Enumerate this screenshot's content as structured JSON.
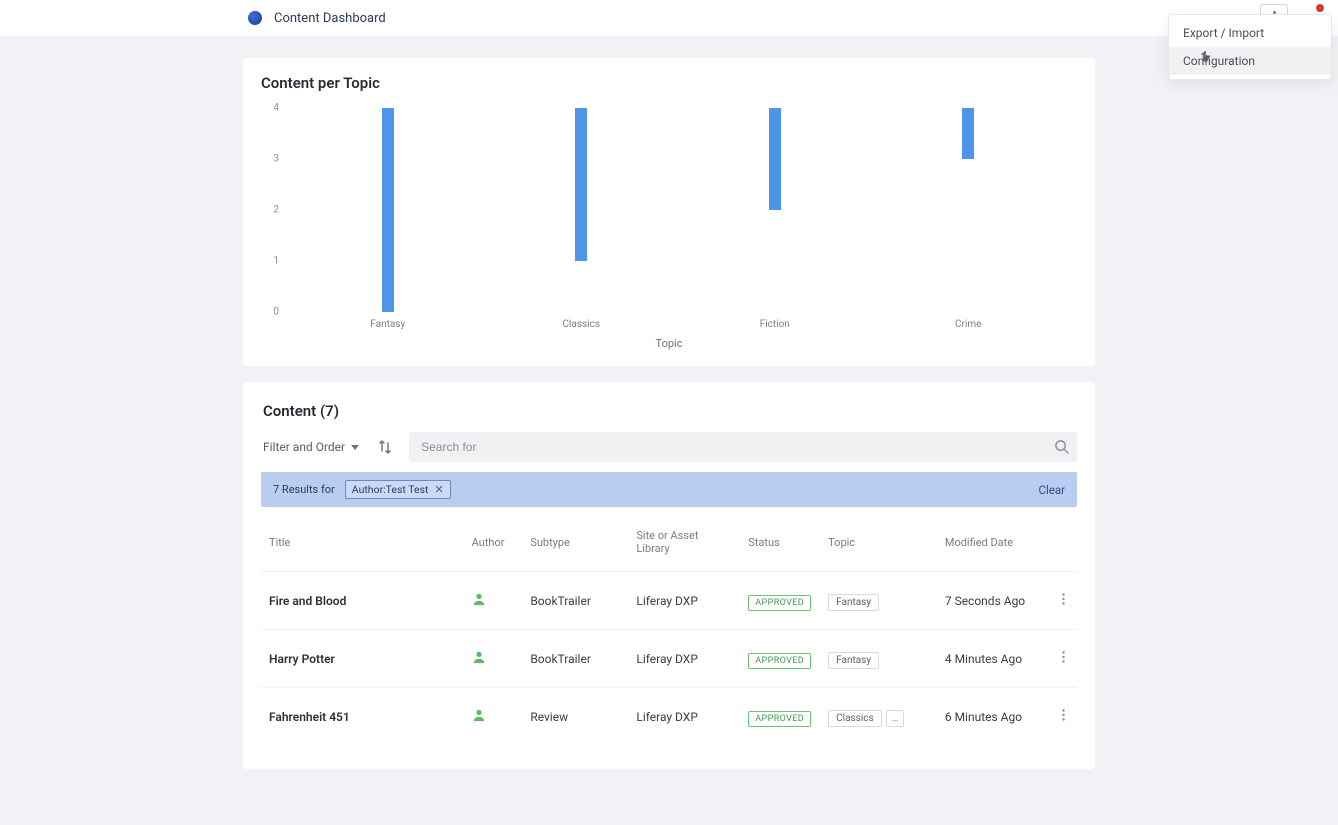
{
  "header": {
    "title": "Content Dashboard"
  },
  "kebab_menu": {
    "items": [
      {
        "label": "Export / Import"
      },
      {
        "label": "Configuration"
      }
    ],
    "hovered_index": 1
  },
  "cards": {
    "chart": {
      "title": "Content per Topic"
    },
    "content": {
      "title_prefix": "Content",
      "count_display": "(7)"
    }
  },
  "chart_data": {
    "type": "bar",
    "title": "Content per Topic",
    "xlabel": "Topic",
    "ylabel": "",
    "ylim": [
      0,
      4
    ],
    "yticks": [
      0,
      1,
      2,
      3,
      4
    ],
    "categories": [
      "Fantasy",
      "Classics",
      "Fiction",
      "Crime"
    ],
    "values": [
      4,
      3,
      2,
      1
    ]
  },
  "toolbar": {
    "filter_order_label": "Filter and Order",
    "search_placeholder": "Search for"
  },
  "filter_summary": {
    "lead": "7 Results for",
    "chip_label": "Author:Test Test",
    "clear_label": "Clear"
  },
  "table": {
    "columns": [
      "Title",
      "Author",
      "Subtype",
      "Site or Asset Library",
      "Status",
      "Topic",
      "Modified Date"
    ],
    "rows": [
      {
        "title": "Fire and Blood",
        "subtype": "BookTrailer",
        "site": "Liferay DXP",
        "status": "APPROVED",
        "topics": [
          "Fantasy"
        ],
        "more_topics": false,
        "modified": "7 Seconds Ago"
      },
      {
        "title": "Harry Potter",
        "subtype": "BookTrailer",
        "site": "Liferay DXP",
        "status": "APPROVED",
        "topics": [
          "Fantasy"
        ],
        "more_topics": false,
        "modified": "4 Minutes Ago"
      },
      {
        "title": "Fahrenheit 451",
        "subtype": "Review",
        "site": "Liferay DXP",
        "status": "APPROVED",
        "topics": [
          "Classics"
        ],
        "more_topics": true,
        "modified": "6 Minutes Ago"
      }
    ]
  }
}
